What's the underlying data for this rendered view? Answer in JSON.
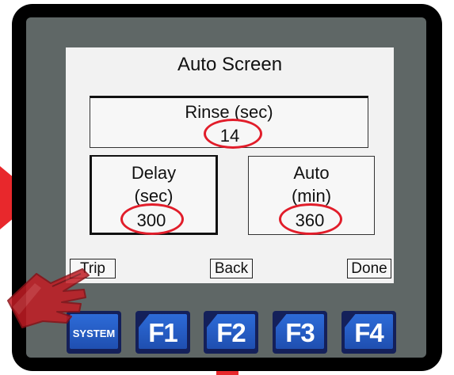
{
  "screen": {
    "title": "Auto Screen",
    "rinse": {
      "label": "Rinse  (sec)",
      "value": "14"
    },
    "delay": {
      "label_line1": "Delay",
      "label_line2": "(sec)",
      "value": "300"
    },
    "auto": {
      "label_line1": "Auto",
      "label_line2": "(min)",
      "value": "360"
    }
  },
  "soft_buttons": {
    "trip": "Trip",
    "back": "Back",
    "done": "Done"
  },
  "function_keys": {
    "system": "SYSTEM",
    "f1": "F1",
    "f2": "F2",
    "f3": "F3",
    "f4": "F4"
  },
  "colors": {
    "highlight": "#e11d2a",
    "arrow": "#e8282c",
    "key_blue": "#2d6bd8",
    "bezel": "#000000",
    "panel": "#5f6766"
  }
}
